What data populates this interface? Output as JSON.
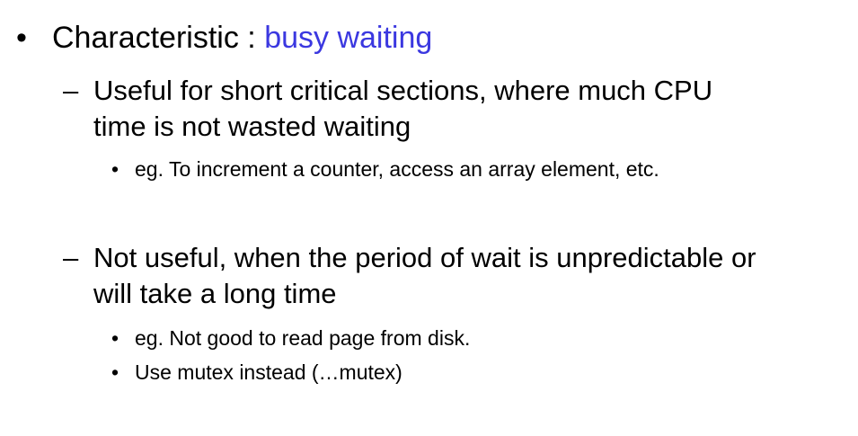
{
  "slide": {
    "heading": {
      "bullet": "•",
      "prefix": "Characteristic : ",
      "highlight": "busy waiting",
      "highlight_color": "#3b38e0"
    },
    "points": [
      {
        "dash": "–",
        "lines": [
          "Useful for short critical sections, where much CPU",
          "time is not wasted waiting"
        ],
        "subpoints": [
          {
            "bullet": "•",
            "text": "eg. To increment a counter, access an array element, etc."
          }
        ]
      },
      {
        "dash": "–",
        "lines": [
          "Not useful, when the period of wait is unpredictable or",
          "will take a long time"
        ],
        "subpoints": [
          {
            "bullet": "•",
            "text": "eg. Not good to read page from disk."
          },
          {
            "bullet": "•",
            "text": "Use mutex instead (…mutex)"
          }
        ]
      }
    ]
  }
}
